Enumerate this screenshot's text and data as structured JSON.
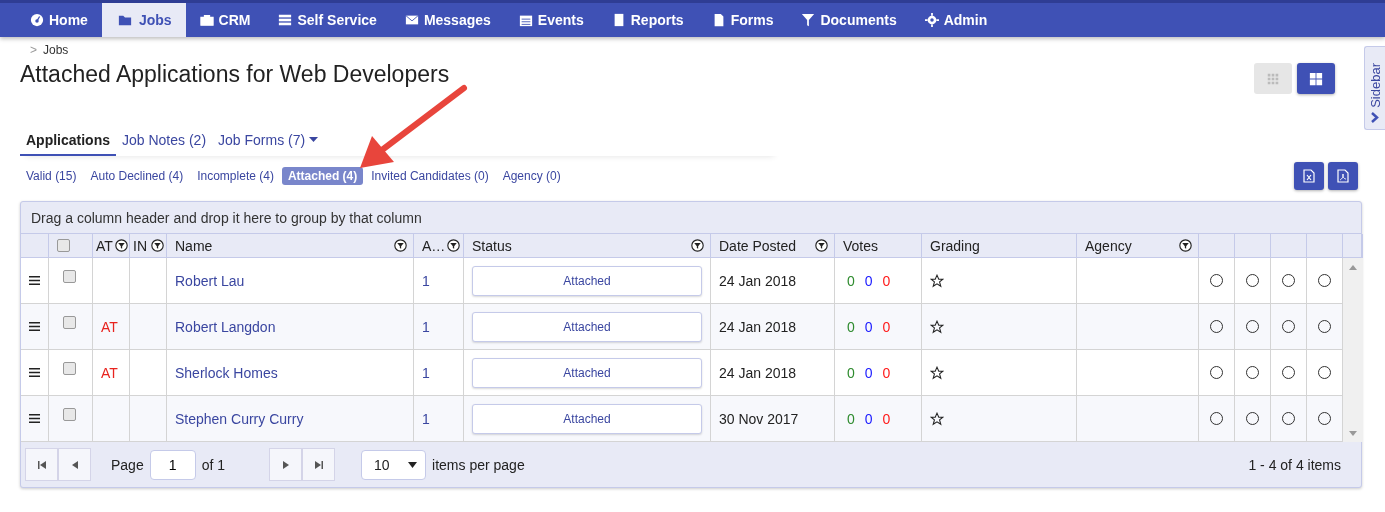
{
  "nav": [
    {
      "label": "Home",
      "selected": false
    },
    {
      "label": "Jobs",
      "selected": true
    },
    {
      "label": "CRM",
      "selected": false
    },
    {
      "label": "Self Service",
      "selected": false
    },
    {
      "label": "Messages",
      "selected": false
    },
    {
      "label": "Events",
      "selected": false
    },
    {
      "label": "Reports",
      "selected": false
    },
    {
      "label": "Forms",
      "selected": false
    },
    {
      "label": "Documents",
      "selected": false
    },
    {
      "label": "Admin",
      "selected": false
    }
  ],
  "breadcrumb": {
    "separator": ">",
    "item": "Jobs"
  },
  "title": "Attached Applications for Web Developers",
  "view_buttons": [
    {
      "kind": "grid",
      "selected": false
    },
    {
      "kind": "tiles",
      "selected": true
    }
  ],
  "sidebar_tab": {
    "label": "Sidebar"
  },
  "tabs": [
    {
      "label": "Applications",
      "selected": true,
      "dropdown": false
    },
    {
      "label": "Job Notes (2)",
      "selected": false,
      "dropdown": false
    },
    {
      "label": "Job Forms (7)",
      "selected": false,
      "dropdown": true
    }
  ],
  "filters": [
    {
      "label": "Valid (15)",
      "selected": false
    },
    {
      "label": "Auto Declined (4)",
      "selected": false
    },
    {
      "label": "Incomplete (4)",
      "selected": false
    },
    {
      "label": "Attached (4)",
      "selected": true
    },
    {
      "label": "Invited Candidates (0)",
      "selected": false
    },
    {
      "label": "Agency (0)",
      "selected": false
    }
  ],
  "export_buttons": [
    {
      "kind": "excel"
    },
    {
      "kind": "pdf"
    }
  ],
  "table": {
    "group_hint": "Drag a column header and drop it here to group by that column",
    "columns": [
      {
        "kind": "menu"
      },
      {
        "kind": "check",
        "checked": false
      },
      {
        "label": "AT",
        "filter": true
      },
      {
        "label": "IN",
        "filter": true
      },
      {
        "label": "Name",
        "filter": true
      },
      {
        "label": "A…",
        "filter": true
      },
      {
        "label": "Status",
        "filter": true
      },
      {
        "label": "Date Posted",
        "filter": true
      },
      {
        "label": "Votes",
        "filter": false
      },
      {
        "label": "Grading",
        "filter": false
      },
      {
        "label": "Agency",
        "filter": true
      },
      {
        "kind": "blank"
      },
      {
        "kind": "blank"
      },
      {
        "kind": "blank"
      },
      {
        "kind": "blank"
      }
    ],
    "rows": [
      {
        "checked": false,
        "name": "Robert Lau",
        "a": "1",
        "status": "Attached",
        "date": "24 Jan 2018",
        "votes": [
          {
            "value": "0",
            "color": "#2e8b2e"
          },
          {
            "value": "0",
            "color": "#1a1aff"
          },
          {
            "value": "0",
            "color": "#ff1a1a"
          }
        ],
        "stars": 0,
        "choices": [
          {
            "selected": false
          },
          {
            "selected": false
          },
          {
            "selected": false
          },
          {
            "selected": false
          }
        ]
      },
      {
        "checked": false,
        "at": "AT",
        "name": "Robert Langdon",
        "a": "1",
        "status": "Attached",
        "date": "24 Jan 2018",
        "votes": [
          {
            "value": "0",
            "color": "#2e8b2e"
          },
          {
            "value": "0",
            "color": "#1a1aff"
          },
          {
            "value": "0",
            "color": "#ff1a1a"
          }
        ],
        "stars": 0,
        "choices": [
          {
            "selected": false
          },
          {
            "selected": false
          },
          {
            "selected": false
          },
          {
            "selected": false
          }
        ]
      },
      {
        "checked": false,
        "at": "AT",
        "name": "Sherlock Homes",
        "a": "1",
        "status": "Attached",
        "date": "24 Jan 2018",
        "votes": [
          {
            "value": "0",
            "color": "#2e8b2e"
          },
          {
            "value": "0",
            "color": "#1a1aff"
          },
          {
            "value": "0",
            "color": "#ff1a1a"
          }
        ],
        "stars": 0,
        "choices": [
          {
            "selected": false
          },
          {
            "selected": false
          },
          {
            "selected": false
          },
          {
            "selected": false
          }
        ]
      },
      {
        "checked": false,
        "name": "Stephen Curry Curry",
        "a": "1",
        "status": "Attached",
        "date": "30 Nov 2017",
        "votes": [
          {
            "value": "0",
            "color": "#2e8b2e"
          },
          {
            "value": "0",
            "color": "#1a1aff"
          },
          {
            "value": "0",
            "color": "#ff1a1a"
          }
        ],
        "stars": 0,
        "choices": [
          {
            "selected": false
          },
          {
            "selected": false
          },
          {
            "selected": false
          },
          {
            "selected": false
          }
        ]
      }
    ],
    "pager": {
      "page_label": "Page",
      "page": "1",
      "of_label": "of 1",
      "page_size": "10",
      "page_size_label": "items per page",
      "summary": "1 - 4 of 4 items"
    }
  }
}
